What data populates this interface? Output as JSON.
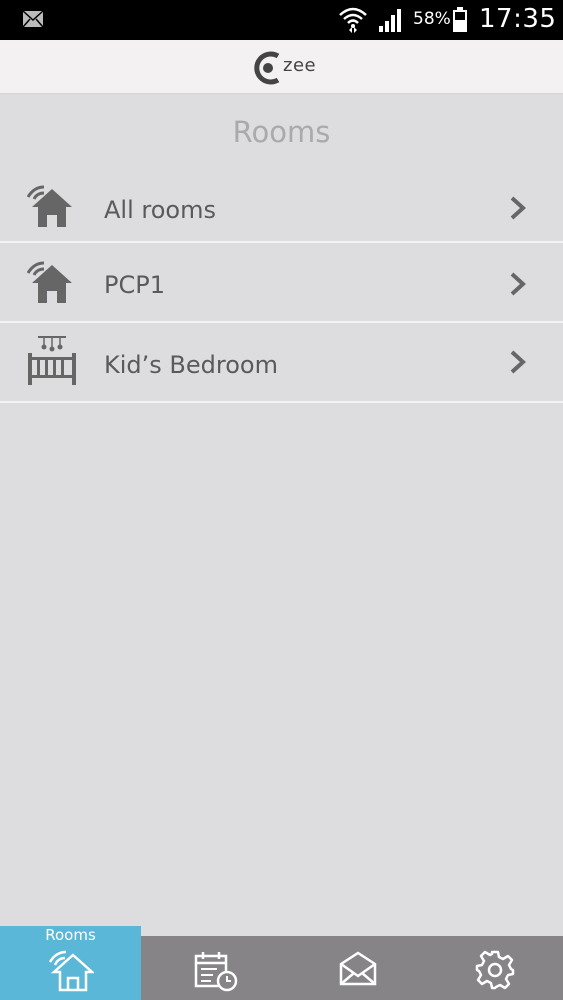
{
  "status_bar": {
    "battery": "58%",
    "time": "17:35",
    "icons": [
      "mail-icon",
      "wifi-icon",
      "signal-icon",
      "battery-icon"
    ]
  },
  "header": {
    "logo_text": "zee"
  },
  "page": {
    "title": "Rooms"
  },
  "rooms": [
    {
      "label": "All rooms",
      "icon": "home-wireless-icon"
    },
    {
      "label": "PCP1",
      "icon": "home-wireless-icon"
    },
    {
      "label": "Kid’s Bedroom",
      "icon": "crib-icon"
    }
  ],
  "tabs": [
    {
      "label": "Rooms",
      "icon": "home-wireless-icon",
      "active": true
    },
    {
      "icon": "calendar-clock-icon"
    },
    {
      "icon": "envelope-icon"
    },
    {
      "icon": "gear-icon"
    }
  ],
  "colors": {
    "background": "#dddcdf",
    "header": "#f3f1f2",
    "tab_bar": "#868487",
    "tab_active": "#5bb7d8",
    "text": "#5a595c",
    "title": "#aaa9ab"
  }
}
